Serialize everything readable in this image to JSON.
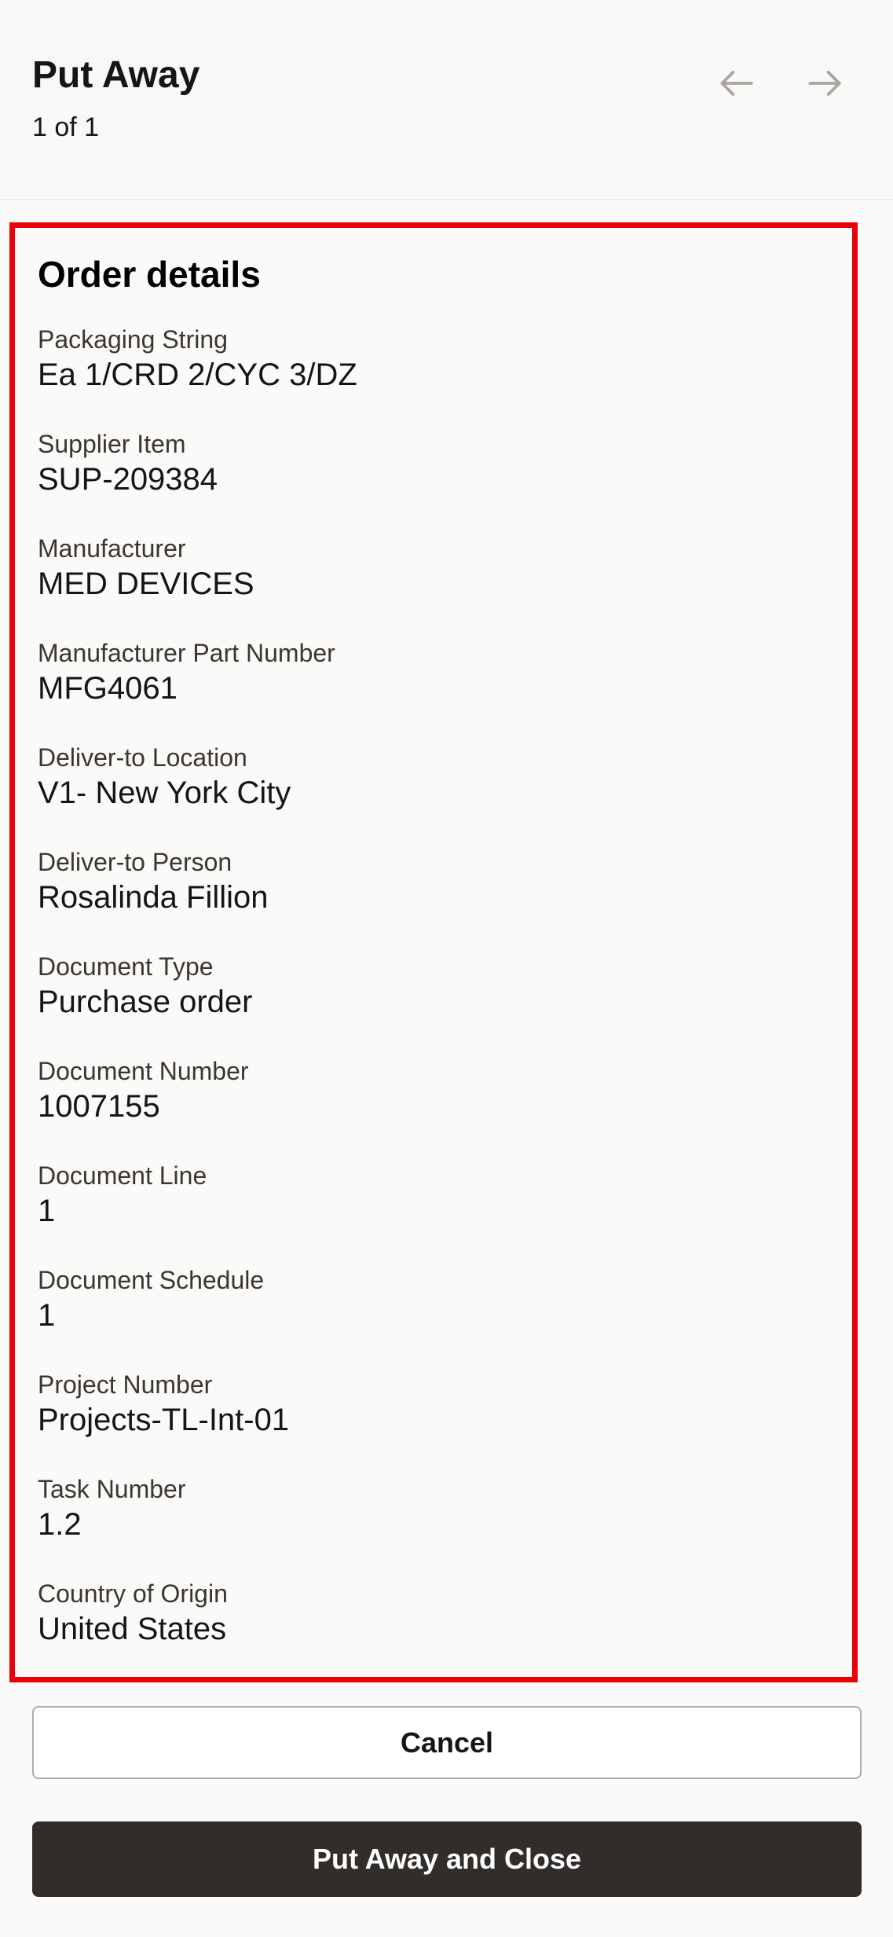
{
  "header": {
    "title": "Put Away",
    "counter": "1 of 1"
  },
  "details": {
    "title": "Order details",
    "fields": [
      {
        "label": "Packaging String",
        "value": "Ea 1/CRD 2/CYC 3/DZ"
      },
      {
        "label": "Supplier Item",
        "value": "SUP-209384"
      },
      {
        "label": "Manufacturer",
        "value": "MED DEVICES"
      },
      {
        "label": "Manufacturer Part Number",
        "value": "MFG4061"
      },
      {
        "label": "Deliver-to Location",
        "value": "V1- New York City"
      },
      {
        "label": "Deliver-to Person",
        "value": "Rosalinda Fillion"
      },
      {
        "label": "Document Type",
        "value": "Purchase order"
      },
      {
        "label": "Document Number",
        "value": "1007155"
      },
      {
        "label": "Document Line",
        "value": "1"
      },
      {
        "label": "Document Schedule",
        "value": "1"
      },
      {
        "label": "Project Number",
        "value": "Projects-TL-Int-01"
      },
      {
        "label": "Task Number",
        "value": "1.2"
      },
      {
        "label": "Country of Origin",
        "value": "United States"
      }
    ]
  },
  "actions": {
    "cancel_label": "Cancel",
    "primary_label": "Put Away and Close"
  },
  "icons": {
    "previous": "arrow-left-icon",
    "next": "arrow-right-icon"
  },
  "colors": {
    "highlight_border": "#e8000b",
    "primary_button": "#312d2a",
    "nav_icon": "#a9a6a2"
  }
}
